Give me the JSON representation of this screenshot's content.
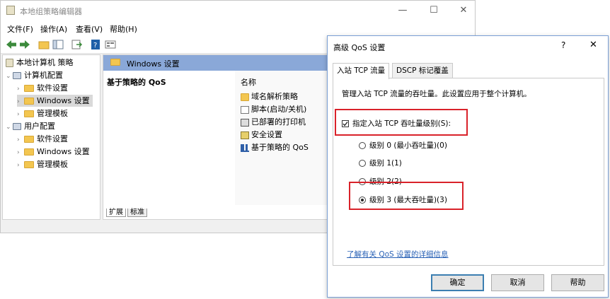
{
  "main_window": {
    "title": "本地组策略编辑器",
    "min_glyph": "—",
    "max_glyph": "☐",
    "close_glyph": "✕"
  },
  "menu": [
    "文件(F)",
    "操作(A)",
    "查看(V)",
    "帮助(H)"
  ],
  "tree": {
    "root": "本地计算机 策略",
    "computer": "计算机配置",
    "computer_children": [
      "软件设置",
      "Windows 设置",
      "管理模板"
    ],
    "user": "用户配置",
    "user_children": [
      "软件设置",
      "Windows 设置",
      "管理模板"
    ],
    "selected": "Windows 设置"
  },
  "right_pane": {
    "header": "Windows 设置",
    "left_title": "基于策略的 QoS",
    "column_name": "名称",
    "items": [
      "域名解析策略",
      "脚本(启动/关机)",
      "已部署的打印机",
      "安全设置",
      "基于策略的 QoS"
    ],
    "bottom_tabs": [
      "扩展",
      "标准"
    ]
  },
  "dialog": {
    "title": "高级 QoS 设置",
    "help_glyph": "?",
    "close_glyph": "✕",
    "tabs": [
      "入站 TCP 流量",
      "DSCP 标记覆盖"
    ],
    "description": "管理入站 TCP 流量的吞吐量。此设置应用于整个计算机。",
    "checkbox_label": "指定入站 TCP 吞吐量级别(S):",
    "checkbox_checked": true,
    "radios": [
      "级别 0 (最小吞吐量)(0)",
      "级别 1(1)",
      "级别 2(2)",
      "级别 3 (最大吞吐量)(3)"
    ],
    "selected_radio": 3,
    "link": "了解有关 QoS 设置的详细信息",
    "buttons": {
      "ok": "确定",
      "cancel": "取消",
      "help": "帮助"
    }
  },
  "colors": {
    "highlight_red": "#d9222a",
    "header_blue": "#8aa8d8",
    "link_blue": "#2a62b6"
  }
}
